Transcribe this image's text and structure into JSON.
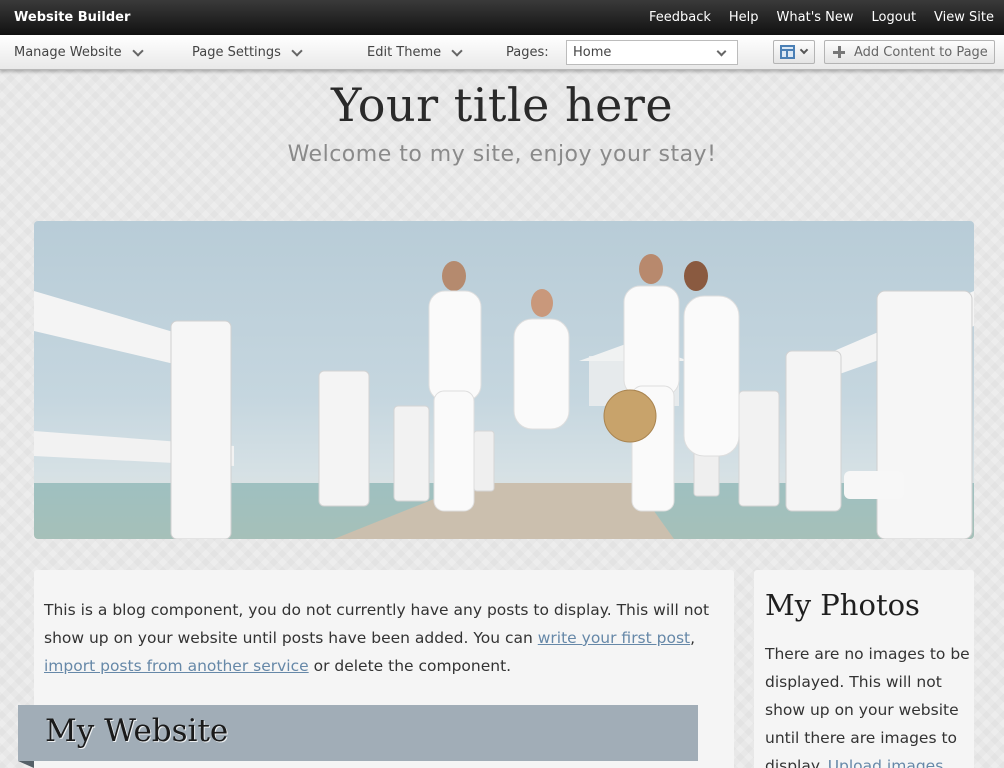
{
  "topbar": {
    "brand": "Website Builder",
    "links": [
      "Feedback",
      "Help",
      "What's New",
      "Logout",
      "View Site"
    ]
  },
  "toolbar": {
    "manage_website": "Manage Website",
    "page_settings": "Page Settings",
    "edit_theme": "Edit Theme",
    "pages_label": "Pages:",
    "pages_selected": "Home",
    "add_content": "Add Content to Page"
  },
  "site": {
    "title": "Your title here",
    "subtitle": "Welcome to my site, enjoy your stay!"
  },
  "blog": {
    "text_1": "This is a blog component, you do not currently have any posts to display. This will not show up on your website until posts have been added. You can ",
    "link_1": "write your first post",
    "text_2": ", ",
    "link_2": "import posts from another service",
    "text_3": " or delete the component."
  },
  "ribbon": {
    "title": "My Website"
  },
  "photos": {
    "title": "My Photos",
    "text": "There are no images to be displayed. This will not show up on your website until there are images to display. ",
    "link": "Upload images"
  },
  "colors": {
    "topbar_bg": "#1c1c1c",
    "link": "#6688a8",
    "ribbon_bg": "#a1adb7",
    "panel_bg": "#f5f5f5"
  },
  "icons": [
    "chevron-down-icon",
    "layout-icon",
    "plus-icon"
  ]
}
